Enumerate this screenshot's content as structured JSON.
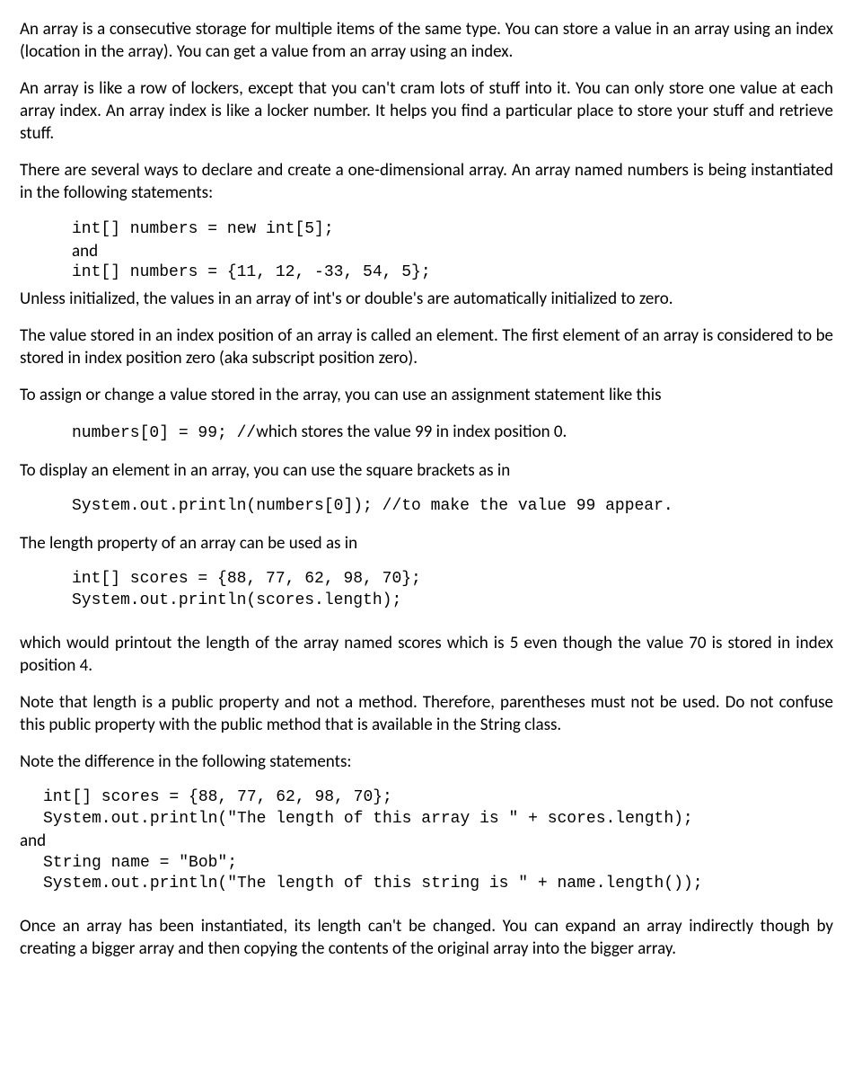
{
  "p1": "An array is a consecutive storage for multiple items of the same type. You can store a value in an array using an index (location in the array). You can get a value from an array using an index.",
  "p2": "An array is like a row of lockers, except that you can't cram lots of stuff into it. You can only store one value at each array index. An array index is like a locker number. It helps you find a particular place to store your stuff and retrieve stuff.",
  "p3": "There are several ways to declare and create a one-dimensional array. An array named numbers is being instantiated in the following statements:",
  "code1_line1": "int[] numbers = new int[5];",
  "code1_line2": "and",
  "code1_line3": "int[] numbers = {11, 12, -33, 54, 5};",
  "p4": "Unless initialized, the values in an array of int's or double's are automatically initialized to zero.",
  "p5": "The value stored in an index position of an array is called an element. The first element of an array is considered to be stored in index position zero (aka subscript position zero).",
  "p6": "To assign or change a value stored in the array, you can use an assignment statement like this",
  "code2_mono": "numbers[0] = 99; //",
  "code2_text": "which stores the value 99 in index position 0.",
  "p7": "To display an element in an array, you can use the square brackets as in",
  "code3": "System.out.println(numbers[0]); //to make the value 99 appear.",
  "p8": "The length property of an array can be used as in",
  "code4_line1": "int[] scores = {88, 77, 62, 98, 70};",
  "code4_line2": "System.out.println(scores.length);",
  "p9": "which would printout the length of the array named scores which is 5 even though the value 70 is stored in index position 4.",
  "p10": "Note that length is a public property and not a method. Therefore, parentheses must not be used. Do not confuse this public property with the public method that is available in the String class.",
  "p11": "Note the difference in the following statements:",
  "code5_line1": "int[] scores = {88, 77, 62, 98, 70};",
  "code5_line2": "System.out.println(\"The length of this array is \" + scores.length);",
  "code5_and": "and",
  "code5_line3": "String name = \"Bob\";",
  "code5_line4": "System.out.println(\"The length of this string is \" + name.length());",
  "p12": "Once an array has been instantiated, its length can't be changed. You can expand an array indirectly though by creating a bigger array and then copying the contents of the original array into the bigger array."
}
